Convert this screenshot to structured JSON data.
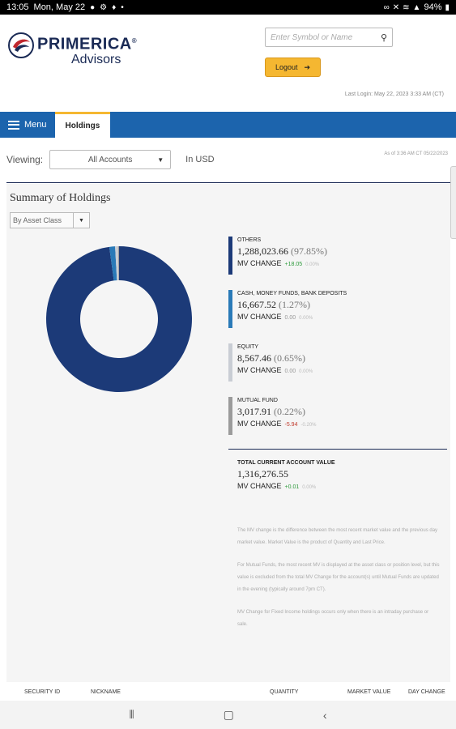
{
  "status_bar": {
    "time": "13:05",
    "date": "Mon, May 22",
    "battery": "94%"
  },
  "brand": {
    "name": "PRIMERICA",
    "registered": "®",
    "subtitle": "Advisors"
  },
  "search": {
    "placeholder": "Enter Symbol or Name"
  },
  "logout": {
    "label": "Logout"
  },
  "last_login": "Last Login: May 22, 2023 3:33 AM (CT)",
  "nav": {
    "menu_label": "Menu",
    "active_tab": "Holdings"
  },
  "viewing": {
    "label": "Viewing:",
    "selected": "All Accounts",
    "currency": "In USD",
    "as_of": "As of 3:36 AM CT 05/22/2023"
  },
  "summary": {
    "title": "Summary of Holdings",
    "group_by": "By Asset Class"
  },
  "chart_data": {
    "type": "pie",
    "categories": [
      "Others",
      "Cash, Money Funds, Bank Deposits",
      "Equity",
      "Mutual Fund"
    ],
    "values": [
      97.85,
      1.27,
      0.65,
      0.22
    ],
    "colors": [
      "#1c3a78",
      "#2a7ab8",
      "#c9cdd4",
      "#9b9b9b"
    ]
  },
  "legend": [
    {
      "category": "OTHERS",
      "value": "1,288,023.66",
      "pct": "(97.85%)",
      "mv_label": "MV CHANGE",
      "mv_change": "+18.05",
      "mv_pct": "0.00%",
      "change_color": "green",
      "bar_color": "#1c3a78"
    },
    {
      "category": "CASH, MONEY FUNDS, BANK DEPOSITS",
      "value": "16,667.52",
      "pct": "(1.27%)",
      "mv_label": "MV CHANGE",
      "mv_change": "0.00",
      "mv_pct": "0.00%",
      "change_color": "gray",
      "bar_color": "#2a7ab8"
    },
    {
      "category": "EQUITY",
      "value": "8,567.46",
      "pct": "(0.65%)",
      "mv_label": "MV CHANGE",
      "mv_change": "0.00",
      "mv_pct": "0.00%",
      "change_color": "gray",
      "bar_color": "#c9cdd4"
    },
    {
      "category": "MUTUAL FUND",
      "value": "3,017.91",
      "pct": "(0.22%)",
      "mv_label": "MV CHANGE",
      "mv_change": "-5.94",
      "mv_pct": "-0.20%",
      "change_color": "red",
      "bar_color": "#9b9b9b"
    }
  ],
  "total": {
    "label": "TOTAL CURRENT ACCOUNT VALUE",
    "value": "1,316,276.55",
    "mv_label": "MV CHANGE",
    "mv_change": "+0.01",
    "mv_pct": "0.00%"
  },
  "notes": [
    "The MV change is the difference between the most recent market value and the previous day market value. Market Value is the product of Quantity and Last Price.",
    "For Mutual Funds, the most recent MV is displayed at the asset class or position level, but this value is excluded from the total MV Change for the account(s) until Mutual Funds are updated in the evening (typically around 7pm CT).",
    "MV Change for Fixed Income holdings occurs only when there is an intraday purchase or sale."
  ],
  "table_headers": {
    "security_id": "SECURITY ID",
    "nickname": "NICKNAME",
    "quantity": "QUANTITY",
    "market_value": "MARKET VALUE",
    "day_change": "DAY CHANGE"
  }
}
